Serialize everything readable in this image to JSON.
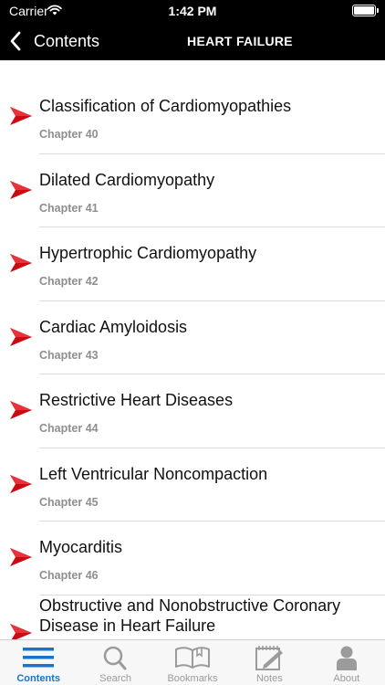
{
  "status_bar": {
    "carrier": "Carrier",
    "time": "1:42 PM"
  },
  "nav": {
    "back_label": "Contents",
    "title": "HEART FAILURE"
  },
  "chapters": [
    {
      "title": "Classification of Cardiomyopathies",
      "chapter": "Chapter 40"
    },
    {
      "title": "Dilated Cardiomyopathy",
      "chapter": "Chapter 41"
    },
    {
      "title": "Hypertrophic Cardiomyopathy",
      "chapter": "Chapter 42"
    },
    {
      "title": "Cardiac Amyloidosis",
      "chapter": "Chapter 43"
    },
    {
      "title": "Restrictive Heart Diseases",
      "chapter": "Chapter 44"
    },
    {
      "title": "Left Ventricular Noncompaction",
      "chapter": "Chapter 45"
    },
    {
      "title": "Myocarditis",
      "chapter": "Chapter 46"
    },
    {
      "title": "Obstructive and Nonobstructive Coronary Disease in Heart Failure",
      "chapter": ""
    }
  ],
  "tabs": [
    {
      "label": "Contents",
      "icon": "list-icon",
      "active": true
    },
    {
      "label": "Search",
      "icon": "magnifier-icon",
      "active": false
    },
    {
      "label": "Bookmarks",
      "icon": "open-book-icon",
      "active": false
    },
    {
      "label": "Notes",
      "icon": "notepad-icon",
      "active": false
    },
    {
      "label": "About",
      "icon": "person-icon",
      "active": false
    }
  ],
  "colors": {
    "bar": "#000000",
    "accent": "#1a73c8",
    "arrow": "#cc0a12",
    "inactive": "#9b9b9b"
  }
}
